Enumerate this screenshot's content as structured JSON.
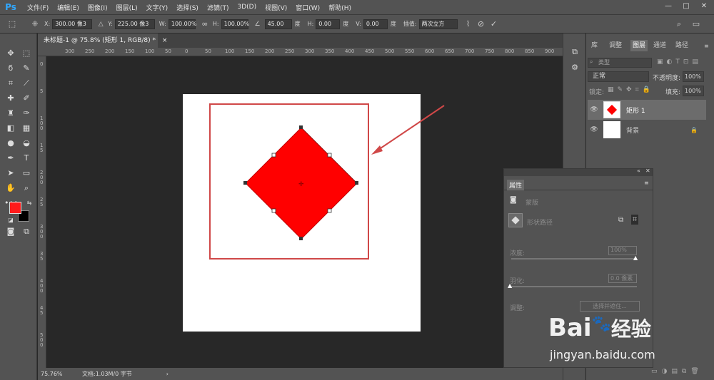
{
  "app": {
    "logo": "Ps"
  },
  "menu": [
    "文件(F)",
    "编辑(E)",
    "图像(I)",
    "图层(L)",
    "文字(Y)",
    "选择(S)",
    "滤镜(T)",
    "3D(D)",
    "视图(V)",
    "窗口(W)",
    "帮助(H)"
  ],
  "window_controls": [
    "—",
    "□",
    "✕"
  ],
  "options": {
    "x_label": "X:",
    "x_value": "300.00 像3",
    "y_label": "Y:",
    "y_value": "225.00 像3",
    "w_label": "W:",
    "w_value": "100.00%",
    "h_label": "H:",
    "h_value": "100.00%",
    "angle_value": "45.00",
    "angle_unit": "度",
    "hskew_label": "H:",
    "hskew_value": "0.00",
    "hskew_unit": "度",
    "vskew_label": "V:",
    "vskew_value": "0.00",
    "vskew_unit": "度",
    "interp_label": "插值:",
    "interp_value": "两次立方"
  },
  "document_tab": {
    "title": "未标题-1 @ 75.8% (矩形 1, RGB/8) *",
    "close": "×"
  },
  "ruler_top": [
    "300",
    "250",
    "200",
    "150",
    "100",
    "50",
    "0",
    "50",
    "100",
    "150",
    "200",
    "250",
    "300",
    "350",
    "400",
    "450",
    "500",
    "550",
    "600",
    "650",
    "700",
    "750",
    "800",
    "850",
    "900"
  ],
  "ruler_left": [
    "0",
    "5",
    "1 0 0",
    "1 5",
    "2 0 0",
    "2 5",
    "3 0 0",
    "3 5",
    "4 0 0",
    "4 5",
    "5 0 0"
  ],
  "status": {
    "zoom": "75.76%",
    "doc": "文档:1.03M/0 字节",
    "arrow": "›"
  },
  "panel_tabs": [
    "库",
    "调整",
    "图层",
    "通道",
    "路径"
  ],
  "layers_panel": {
    "filter_placeholder": "类型",
    "blend_mode": "正常",
    "opacity_label": "不透明度:",
    "opacity_value": "100%",
    "lock_label": "锁定:",
    "fill_label": "填充:",
    "fill_value": "100%",
    "layers": [
      {
        "name": "矩形 1",
        "selected": true
      },
      {
        "name": "背景",
        "selected": false
      }
    ]
  },
  "properties_panel": {
    "title": "属性",
    "mask_label": "蒙版",
    "shape_path_label": "形状路径",
    "density_label": "浓度:",
    "density_value": "100%",
    "feather_label": "羽化:",
    "feather_value": "0.0 像素",
    "adjust_label": "调整:",
    "select_button": "选择并遮住..."
  },
  "watermark": {
    "text": "Bai",
    "text2": "经验",
    "url": "jingyan.baidu.com"
  },
  "colors": {
    "shape_fill": "#ff0000",
    "selection_border": "#d04848",
    "foreground": "#ff1a1a",
    "background": "#000000"
  }
}
